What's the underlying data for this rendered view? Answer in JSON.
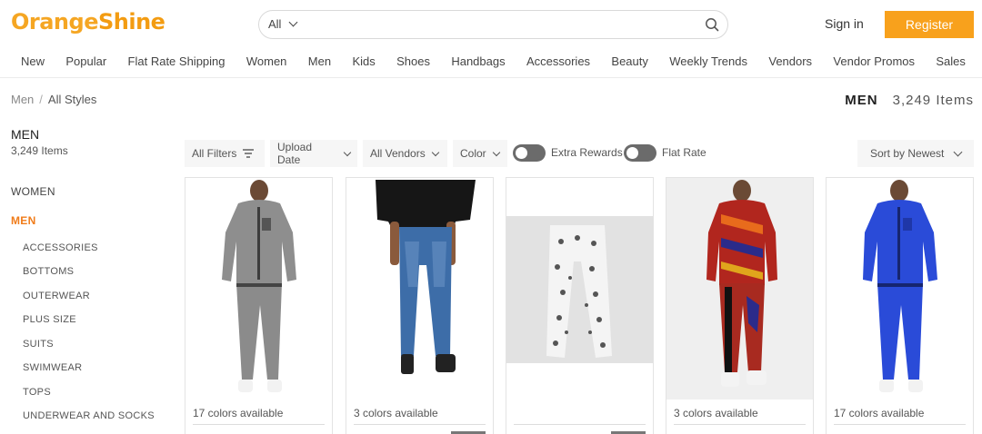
{
  "header": {
    "logo": {
      "part1": "Orange",
      "part2": "Shine"
    },
    "search_scope": "All",
    "search_icon": "magnifier-icon",
    "signin_label": "Sign in",
    "register_label": "Register"
  },
  "nav": [
    "New",
    "Popular",
    "Flat Rate Shipping",
    "Women",
    "Men",
    "Kids",
    "Shoes",
    "Handbags",
    "Accessories",
    "Beauty",
    "Weekly Trends",
    "Vendors",
    "Vendor Promos",
    "Sales"
  ],
  "breadcrumb": {
    "root": "Men",
    "separator": "/",
    "current": "All Styles"
  },
  "page_heading": {
    "title": "MEN",
    "count": "3,249 Items"
  },
  "sidebar": {
    "title": "MEN",
    "count": "3,249 Items",
    "categories": [
      "WOMEN",
      "MEN"
    ],
    "subcategories": [
      "ACCESSORIES",
      "BOTTOMS",
      "OUTERWEAR",
      "PLUS SIZE",
      "SUITS",
      "SWIMWEAR",
      "TOPS",
      "UNDERWEAR AND SOCKS"
    ]
  },
  "filters": {
    "all_filters": "All Filters",
    "upload_date": "Upload Date",
    "all_vendors": "All Vendors",
    "color": "Color",
    "extra_rewards": "Extra Rewards",
    "flat_rate": "Flat Rate",
    "sort": "Sort by Newest"
  },
  "products": [
    {
      "colors": "17 colors available"
    },
    {
      "colors": "3 colors available"
    },
    {
      "colors": ""
    },
    {
      "colors": "3 colors available"
    },
    {
      "colors": "17 colors available"
    }
  ],
  "colors": {
    "brand": "#f39c12",
    "register_bg": "#f8a11c",
    "active_category": "#f07c1a"
  }
}
